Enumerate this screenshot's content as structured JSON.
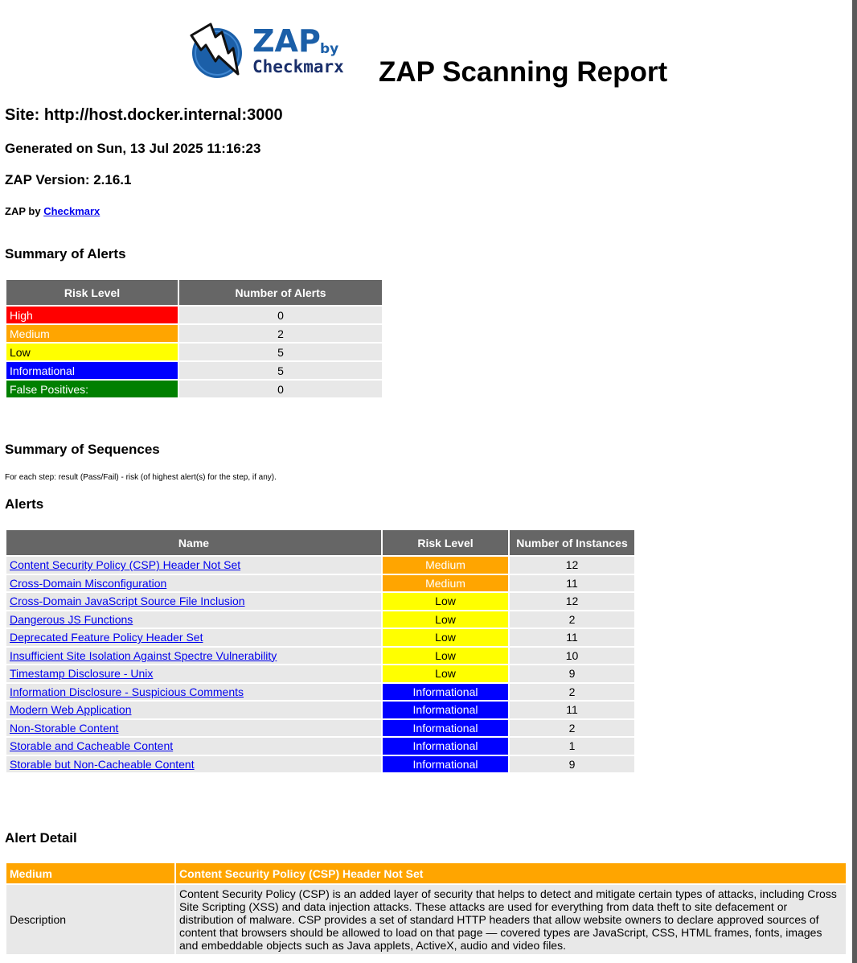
{
  "header": {
    "logo": {
      "zap": "ZAP",
      "by": "by",
      "brand": "Checkmarx"
    },
    "title": "ZAP Scanning Report"
  },
  "site": "Site: http://host.docker.internal:3000",
  "generated": "Generated on Sun, 13 Jul 2025 11:16:23",
  "version": "ZAP Version: 2.16.1",
  "zap_by": {
    "prefix": "ZAP by",
    "link": "Checkmarx"
  },
  "summary_alerts": {
    "heading": "Summary of Alerts",
    "columns": [
      "Risk Level",
      "Number of Alerts"
    ],
    "rows": [
      {
        "level": "High",
        "count": "0"
      },
      {
        "level": "Medium",
        "count": "2"
      },
      {
        "level": "Low",
        "count": "5"
      },
      {
        "level": "Informational",
        "count": "5"
      },
      {
        "level": "False Positives:",
        "count": "0"
      }
    ]
  },
  "summary_sequences": {
    "heading": "Summary of Sequences",
    "note": "For each step: result (Pass/Fail) - risk (of highest alert(s) for the step, if any)."
  },
  "alerts": {
    "heading": "Alerts",
    "columns": [
      "Name",
      "Risk Level",
      "Number of Instances"
    ],
    "rows": [
      {
        "name": "Content Security Policy (CSP) Header Not Set",
        "risk": "Medium",
        "count": "12"
      },
      {
        "name": "Cross-Domain Misconfiguration",
        "risk": "Medium",
        "count": "11"
      },
      {
        "name": "Cross-Domain JavaScript Source File Inclusion",
        "risk": "Low",
        "count": "12"
      },
      {
        "name": "Dangerous JS Functions",
        "risk": "Low",
        "count": "2"
      },
      {
        "name": "Deprecated Feature Policy Header Set",
        "risk": "Low",
        "count": "11"
      },
      {
        "name": "Insufficient Site Isolation Against Spectre Vulnerability",
        "risk": "Low",
        "count": "10"
      },
      {
        "name": "Timestamp Disclosure - Unix",
        "risk": "Low",
        "count": "9"
      },
      {
        "name": "Information Disclosure - Suspicious Comments",
        "risk": "Informational",
        "count": "2"
      },
      {
        "name": "Modern Web Application",
        "risk": "Informational",
        "count": "11"
      },
      {
        "name": "Non-Storable Content",
        "risk": "Informational",
        "count": "2"
      },
      {
        "name": "Storable and Cacheable Content",
        "risk": "Informational",
        "count": "1"
      },
      {
        "name": "Storable but Non-Cacheable Content",
        "risk": "Informational",
        "count": "9"
      }
    ]
  },
  "alert_detail": {
    "heading": "Alert Detail",
    "risk": "Medium",
    "title": "Content Security Policy (CSP) Header Not Set",
    "description_label": "Description",
    "description": "Content Security Policy (CSP) is an added layer of security that helps to detect and mitigate certain types of attacks, including Cross Site Scripting (XSS) and data injection attacks. These attacks are used for everything from data theft to site defacement or distribution of malware. CSP provides a set of standard HTTP headers that allow website owners to declare approved sources of content that browsers should be allowed to load on that page — covered types are JavaScript, CSS, HTML frames, fonts, images and embeddable objects such as Java applets, ActiveX, audio and video files."
  },
  "colors": {
    "high": "#ff0000",
    "medium": "#ffa500",
    "low": "#ffff00",
    "informational": "#0000ff",
    "false_positive": "#008000",
    "header_bg": "#666666",
    "cell_bg": "#e8e8e8",
    "link": "#0000ee"
  }
}
